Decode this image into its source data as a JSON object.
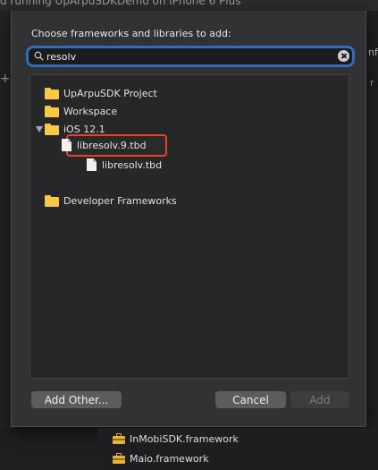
{
  "background": {
    "title_text": "d running UpArpuSDKDemo on iPhone 6 Plus",
    "left_plus": "+",
    "right_text": "nf",
    "right_mark": "r"
  },
  "dialog": {
    "title": "Choose frameworks and libraries to add:",
    "search": {
      "value": "resolv",
      "placeholder": ""
    },
    "tree": [
      {
        "label": "UpArpuSDK Project",
        "icon": "folder-icon"
      },
      {
        "label": "Workspace",
        "icon": "folder-icon"
      },
      {
        "label": "iOS 12.1",
        "icon": "folder-icon",
        "expanded": true
      },
      {
        "label": "libresolv.9.tbd",
        "icon": "file-icon",
        "highlighted": true
      },
      {
        "label": "libresolv.tbd",
        "icon": "file-icon"
      },
      {
        "label": "Developer Frameworks",
        "icon": "folder-icon"
      }
    ],
    "buttons": {
      "add_other": "Add Other...",
      "cancel": "Cancel",
      "add": "Add"
    }
  },
  "frameworks": [
    {
      "label": "InMobiSDK.framework",
      "icon": "toolbox-icon"
    },
    {
      "label": "Maio.framework",
      "icon": "toolbox-icon"
    }
  ],
  "colors": {
    "accent": "#2f6fb8",
    "highlight_border": "#e8412c",
    "folder": "#f7c948"
  }
}
